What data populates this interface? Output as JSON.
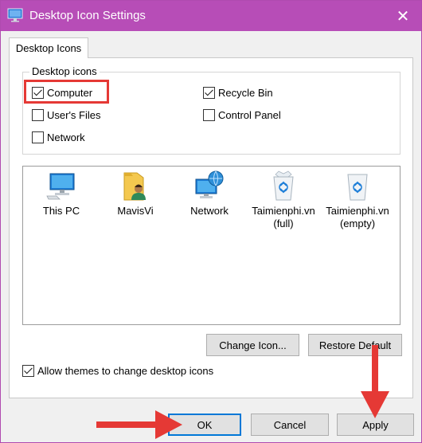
{
  "window": {
    "title": "Desktop Icon Settings",
    "close_glyph": "✕"
  },
  "tab": {
    "label": "Desktop Icons"
  },
  "group": {
    "legend": "Desktop icons",
    "checkboxes": [
      {
        "label": "Computer",
        "checked": true
      },
      {
        "label": "Recycle Bin",
        "checked": true
      },
      {
        "label": "User's Files",
        "checked": false
      },
      {
        "label": "Control Panel",
        "checked": false
      },
      {
        "label": "Network",
        "checked": false
      }
    ]
  },
  "icons": [
    {
      "icon": "computer-icon",
      "line1": "This PC",
      "line2": ""
    },
    {
      "icon": "user-folder-icon",
      "line1": "MavisVi",
      "line2": ""
    },
    {
      "icon": "network-icon",
      "line1": "Network",
      "line2": ""
    },
    {
      "icon": "recycle-bin-full-icon",
      "line1": "Taimienphi.vn",
      "line2": "(full)"
    },
    {
      "icon": "recycle-bin-empty-icon",
      "line1": "Taimienphi.vn",
      "line2": "(empty)"
    }
  ],
  "buttons": {
    "change_icon": "Change Icon...",
    "restore_default": "Restore Default",
    "ok": "OK",
    "cancel": "Cancel",
    "apply": "Apply"
  },
  "themes_checkbox": {
    "label": "Allow themes to change desktop icons",
    "checked": true
  },
  "colors": {
    "titlebar": "#b74db7",
    "annotation": "#e53935"
  }
}
